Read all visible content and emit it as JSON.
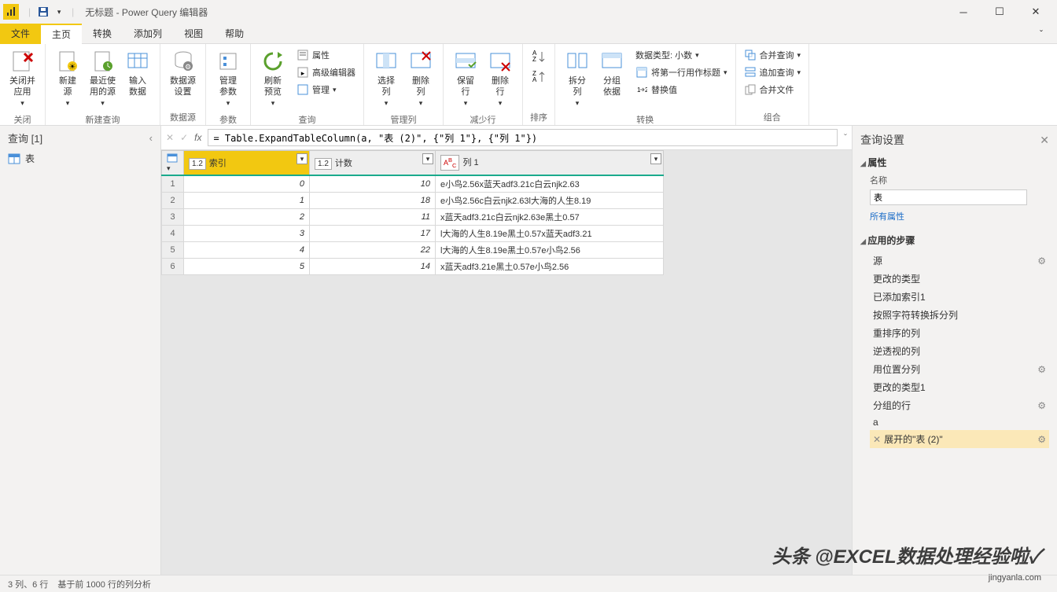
{
  "window": {
    "title": "无标题 - Power Query 编辑器"
  },
  "tabs": {
    "file": "文件",
    "home": "主页",
    "transform": "转换",
    "addcol": "添加列",
    "view": "视图",
    "help": "帮助"
  },
  "ribbon": {
    "close_apply": "关闭并\n应用",
    "close_group": "关闭",
    "new_source": "新建\n源",
    "recent_source": "最近使\n用的源",
    "enter_data": "输入\n数据",
    "new_query_group": "新建查询",
    "datasource_settings": "数据源\n设置",
    "datasource_group": "数据源",
    "params": "管理\n参数",
    "params_group": "参数",
    "refresh": "刷新\n预览",
    "properties": "属性",
    "adv_editor": "高级编辑器",
    "manage": "管理",
    "query_group": "查询",
    "choose_col": "选择\n列",
    "remove_col": "删除\n列",
    "manage_cols_group": "管理列",
    "keep_rows": "保留\n行",
    "remove_rows": "删除\n行",
    "reduce_rows_group": "减少行",
    "sort_group": "排序",
    "split_col": "拆分\n列",
    "group_by": "分组\n依据",
    "datatype": "数据类型: 小数",
    "first_row_header": "将第一行用作标题",
    "replace": "替换值",
    "transform_group": "转换",
    "merge_q": "合并查询",
    "append_q": "追加查询",
    "combine_files": "合并文件",
    "combine_group": "组合"
  },
  "left_panel": {
    "header": "查询 [1]",
    "item": "表"
  },
  "formula": "= Table.ExpandTableColumn(a, \"表 (2)\", {\"列 1\"}, {\"列 1\"})",
  "columns": {
    "c1_type": "1.2",
    "c1_name": "索引",
    "c2_type": "1.2",
    "c2_name": "计数",
    "c3_type": "ABC",
    "c3_name": "列 1"
  },
  "rows": [
    {
      "n": "1",
      "idx": "0",
      "cnt": "10",
      "txt": "e小鸟2.56x蓝天adf3.21c白云njk2.63"
    },
    {
      "n": "2",
      "idx": "1",
      "cnt": "18",
      "txt": "e小鸟2.56c白云njk2.63l大海的人生8.19"
    },
    {
      "n": "3",
      "idx": "2",
      "cnt": "11",
      "txt": "x蓝天adf3.21c白云njk2.63e黑土0.57"
    },
    {
      "n": "4",
      "idx": "3",
      "cnt": "17",
      "txt": "l大海的人生8.19e黑土0.57x蓝天adf3.21"
    },
    {
      "n": "5",
      "idx": "4",
      "cnt": "22",
      "txt": "l大海的人生8.19e黑土0.57e小鸟2.56"
    },
    {
      "n": "6",
      "idx": "5",
      "cnt": "14",
      "txt": "x蓝天adf3.21e黑土0.57e小鸟2.56"
    }
  ],
  "right": {
    "header": "查询设置",
    "properties": "属性",
    "name_label": "名称",
    "name_value": "表",
    "all_props": "所有属性",
    "steps_header": "应用的步骤",
    "steps": [
      {
        "label": "源",
        "gear": true
      },
      {
        "label": "更改的类型",
        "gear": false
      },
      {
        "label": "已添加索引1",
        "gear": false
      },
      {
        "label": "按照字符转换拆分列",
        "gear": false
      },
      {
        "label": "重排序的列",
        "gear": false
      },
      {
        "label": "逆透视的列",
        "gear": false
      },
      {
        "label": "用位置分列",
        "gear": true
      },
      {
        "label": "更改的类型1",
        "gear": false
      },
      {
        "label": "分组的行",
        "gear": true
      },
      {
        "label": "a",
        "gear": false
      },
      {
        "label": "展开的\"表 (2)\"",
        "gear": true,
        "selected": true,
        "prefix": "✕"
      }
    ]
  },
  "status": {
    "cols_rows": "3 列、6 行",
    "profiling": "基于前 1000 行的列分析"
  },
  "watermark": "头条 @EXCEL数据处理经验啦✓",
  "watermark2": "jingyanla.com"
}
